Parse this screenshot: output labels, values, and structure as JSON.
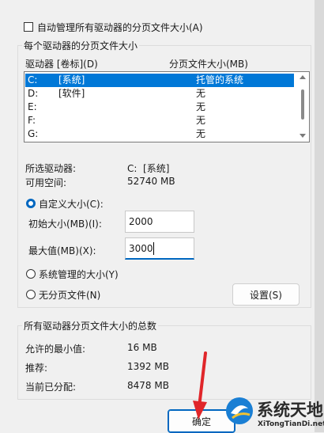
{
  "auto_manage": {
    "label": "自动管理所有驱动器的分页文件大小(A)",
    "checked": false
  },
  "drive_group": {
    "title": "每个驱动器的分页文件大小",
    "headers": {
      "drive": "驱动器 [卷标](D)",
      "size": "分页文件大小(MB)"
    },
    "rows": [
      {
        "drive": "C:",
        "label": "[系统]",
        "size": "托管的系统",
        "selected": true
      },
      {
        "drive": "D:",
        "label": "[软件]",
        "size": "无",
        "selected": false
      },
      {
        "drive": "E:",
        "label": "",
        "size": "无",
        "selected": false
      },
      {
        "drive": "F:",
        "label": "",
        "size": "无",
        "selected": false
      },
      {
        "drive": "G:",
        "label": "",
        "size": "无",
        "selected": false
      }
    ],
    "selected_drive_label": "所选驱动器:",
    "selected_drive_value": "C:  [系统]",
    "free_space_label": "可用空间:",
    "free_space_value": "52740 MB",
    "custom_size": {
      "label": "自定义大小(C):",
      "checked": true
    },
    "initial_size": {
      "label": "初始大小(MB)(I):",
      "value": "2000"
    },
    "max_size": {
      "label": "最大值(MB)(X):",
      "value": "3000"
    },
    "system_managed": {
      "label": "系统管理的大小(Y)",
      "checked": false
    },
    "no_paging": {
      "label": "无分页文件(N)",
      "checked": false
    },
    "set_button": "设置(S)"
  },
  "totals_group": {
    "title": "所有驱动器分页文件大小的总数",
    "min_label": "允许的最小值:",
    "min_value": "16 MB",
    "recommended_label": "推荐:",
    "recommended_value": "1392 MB",
    "allocated_label": "当前已分配:",
    "allocated_value": "8478 MB"
  },
  "ok_button": "确定",
  "watermark": {
    "name": "系统天地",
    "url": "XiTongTianDi.net"
  },
  "colors": {
    "accent": "#0067c0",
    "selection": "#0078d7",
    "arrow": "#e0262a"
  }
}
